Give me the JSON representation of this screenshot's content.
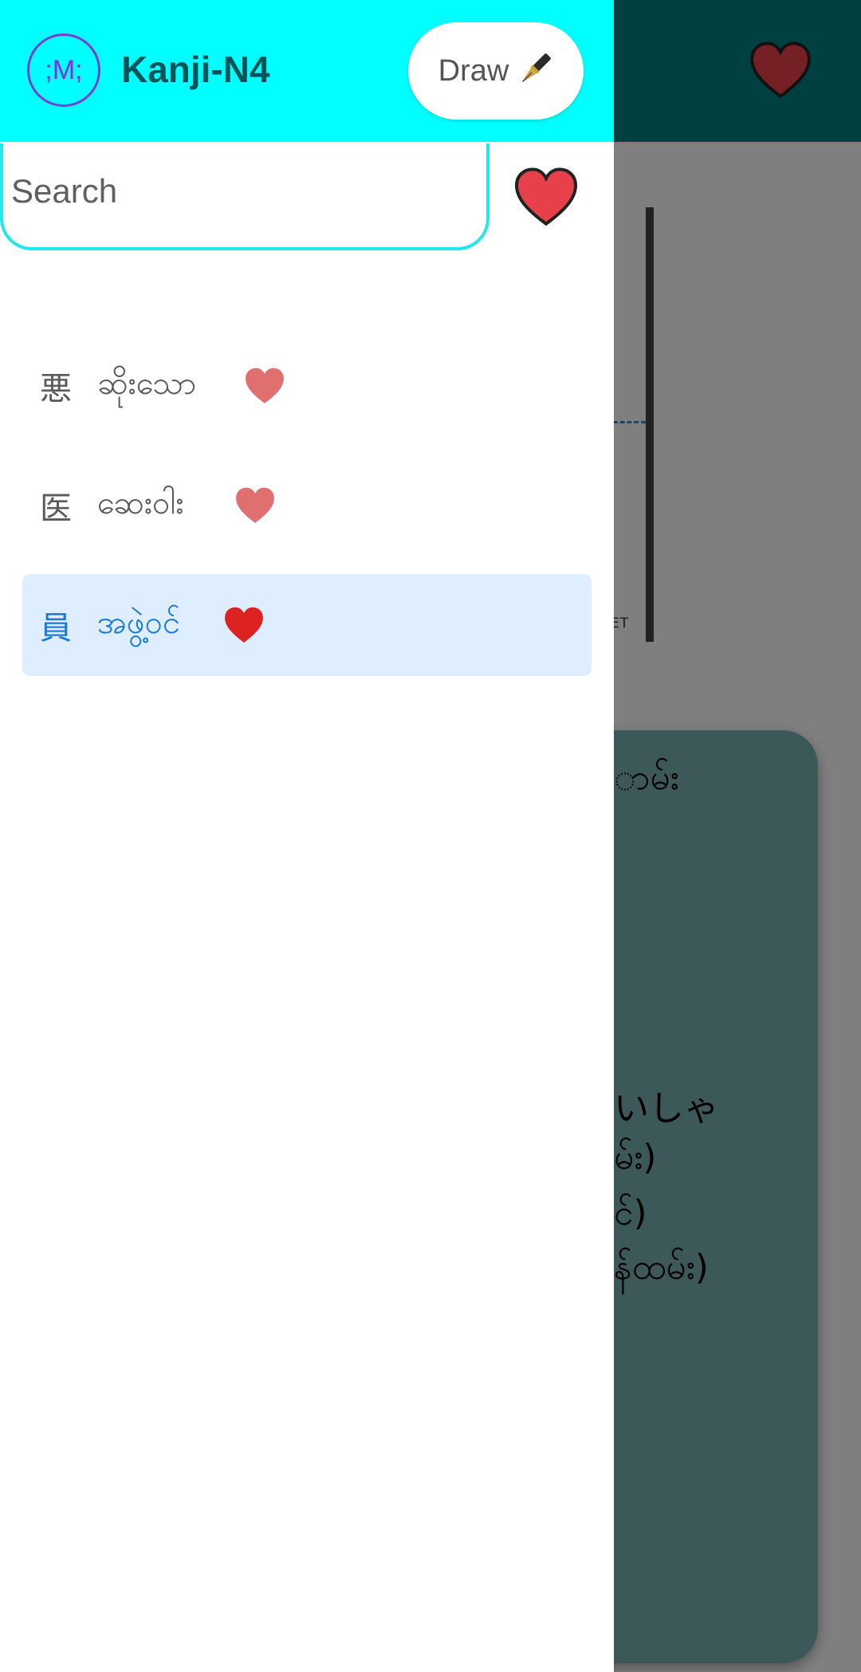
{
  "background": {
    "board_label": "ET",
    "card_lines": [
      "ာမ်း",
      "いしゃ",
      "မ်း)",
      "င်)",
      "န်ထမ်း)"
    ]
  },
  "drawer": {
    "logo_text": ";M;",
    "app_title": "Kanji-N4",
    "draw_button_label": "Draw",
    "search": {
      "placeholder": "Search",
      "value": ""
    },
    "items": [
      {
        "kanji": "悪",
        "meaning": "ဆိုးသော",
        "favorite_color": "#e07070"
      },
      {
        "kanji": "医",
        "meaning": "ဆေးဝါး",
        "favorite_color": "#e07070"
      },
      {
        "kanji": "員",
        "meaning": "အဖွဲ့ဝင်",
        "favorite_color": "#dd2222",
        "selected": true
      }
    ]
  },
  "colors": {
    "header": "#00ffff",
    "bg_topbar": "#008080",
    "favorite_red": "#e8404a",
    "selected_bg": "#dfeefe",
    "selected_text": "#1a7ad6"
  }
}
